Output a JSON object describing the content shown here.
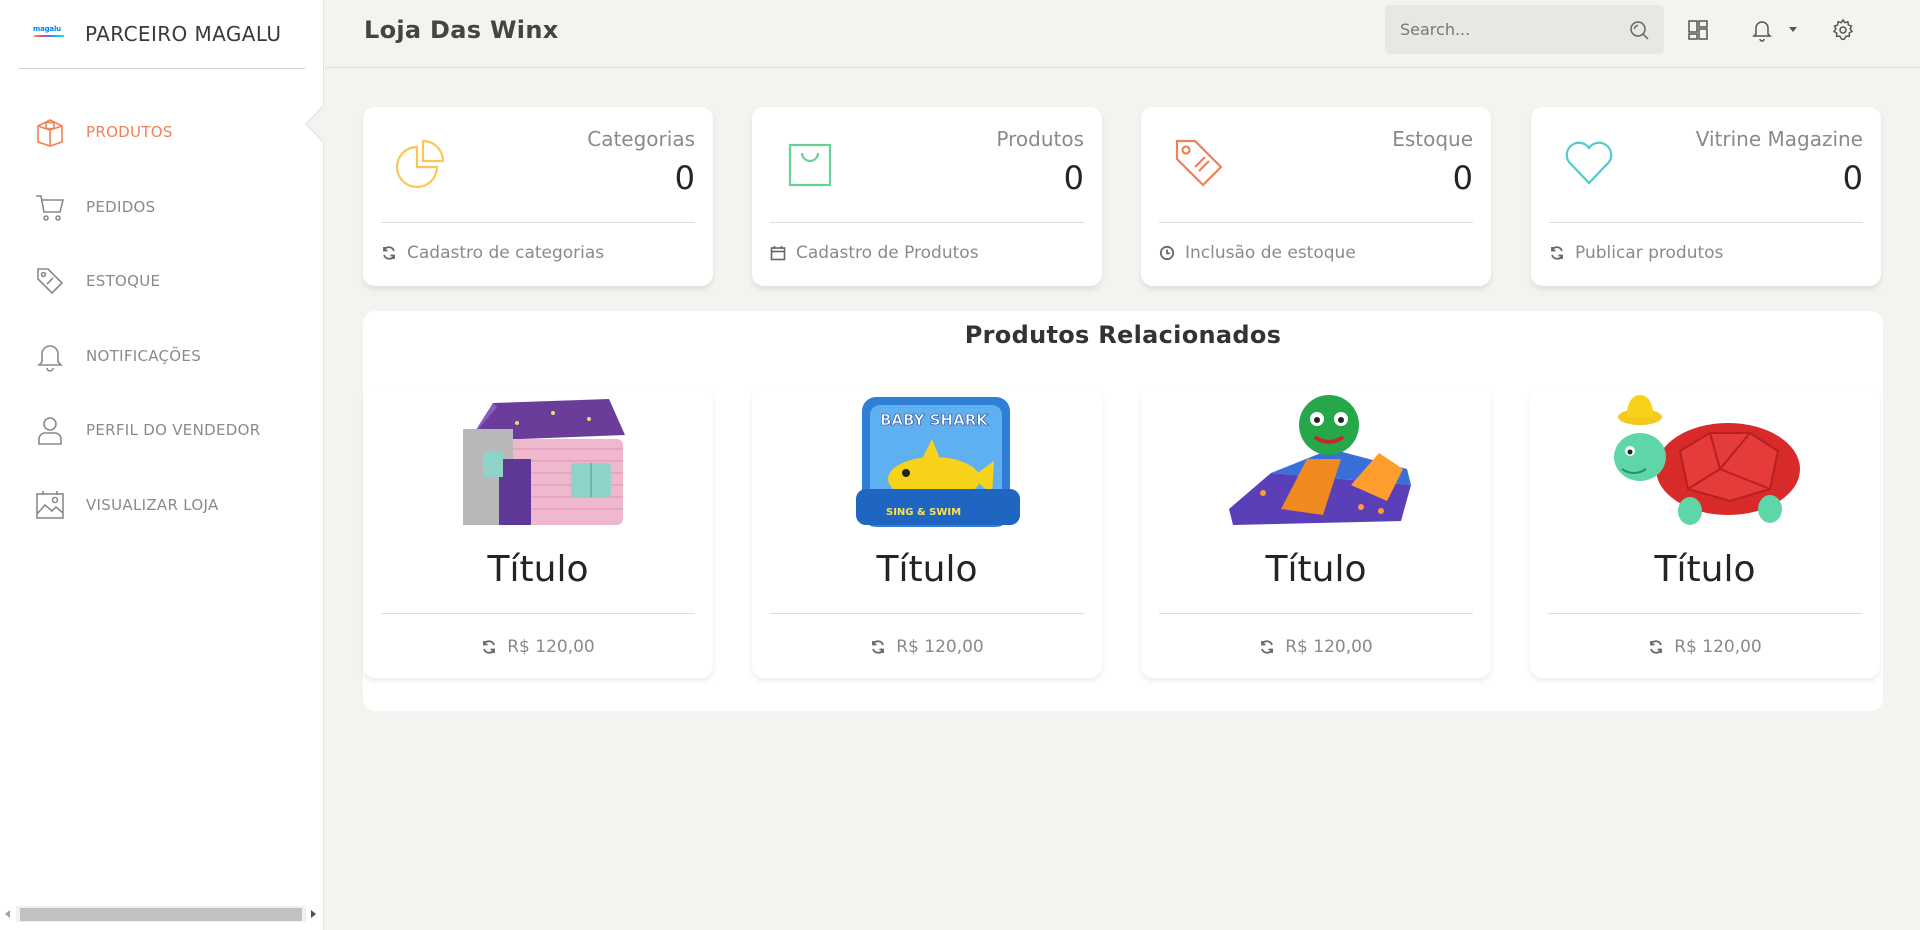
{
  "brand": {
    "name": "PARCEIRO MAGALU",
    "logo_text": "magalu"
  },
  "sidebar": {
    "items": [
      {
        "label": "PRODUTOS",
        "icon": "box-icon",
        "active": true
      },
      {
        "label": "PEDIDOS",
        "icon": "cart-icon",
        "active": false
      },
      {
        "label": "ESTOQUE",
        "icon": "tags-icon",
        "active": false
      },
      {
        "label": "NOTIFICAÇÕES",
        "icon": "bell-icon",
        "active": false
      },
      {
        "label": "PERFIL DO VENDEDOR",
        "icon": "user-icon",
        "active": false
      },
      {
        "label": "VISUALIZAR LOJA",
        "icon": "image-icon",
        "active": false
      }
    ]
  },
  "header": {
    "title": "Loja Das Winx",
    "search_placeholder": "Search...",
    "search_value": ""
  },
  "stats": [
    {
      "label": "Categorias",
      "value": "0",
      "footer": "Cadastro de categorias",
      "icon": "pie-chart-icon",
      "footer_icon": "refresh-icon",
      "color": "#fbc658"
    },
    {
      "label": "Produtos",
      "value": "0",
      "footer": "Cadastro de Produtos",
      "icon": "shopping-bag-icon",
      "footer_icon": "calendar-icon",
      "color": "#6bd098"
    },
    {
      "label": "Estoque",
      "value": "0",
      "footer": "Inclusão de estoque",
      "icon": "price-tag-icon",
      "footer_icon": "clock-icon",
      "color": "#ef8157"
    },
    {
      "label": "Vitrine Magazine",
      "value": "0",
      "footer": "Publicar produtos",
      "icon": "heart-icon",
      "footer_icon": "refresh-icon",
      "color": "#51cbce"
    }
  ],
  "related": {
    "title": "Produtos Relacionados",
    "products": [
      {
        "title": "Título",
        "price": "R$ 120,00",
        "image": "playhouse"
      },
      {
        "title": "Título",
        "price": "R$ 120,00",
        "image": "baby-shark-toy"
      },
      {
        "title": "Título",
        "price": "R$ 120,00",
        "image": "inflatable-slide"
      },
      {
        "title": "Título",
        "price": "R$ 120,00",
        "image": "turtle-toy"
      }
    ]
  },
  "colors": {
    "accent": "#ef8157",
    "background": "#f4f3ef",
    "muted": "#8a8a8a"
  }
}
